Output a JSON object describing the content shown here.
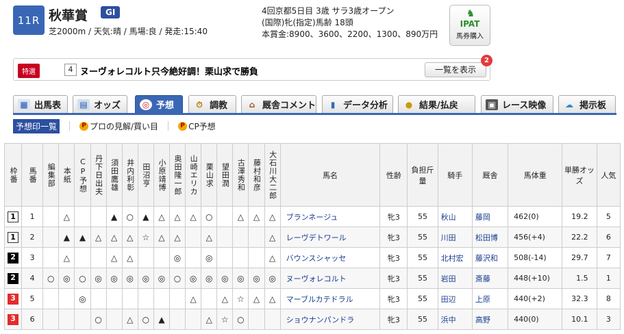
{
  "race": {
    "number": "11R",
    "name": "秋華賞",
    "grade": "GI",
    "conditions": "芝2000m / 天気:晴 / 馬場:良 / 発走:15:40",
    "info_line1": "4回京都5日目 3歳 サラ3歳オープン",
    "info_line2": "(国際)牝(指定)馬齢 18頭",
    "info_line3": "本賞金:8900、3600、2200、1300、890万円"
  },
  "ipat": {
    "logo": "IPAT",
    "label": "馬券購入"
  },
  "news": {
    "tag": "特選",
    "horse_num": "4",
    "text": "ヌーヴォレコルト只今絶好調！栗山求で勝負",
    "button": "一覧を表示",
    "badge": "2"
  },
  "tabs": [
    {
      "label": "出馬表",
      "icon": "table-icon"
    },
    {
      "label": "オッズ",
      "icon": "grid-icon"
    },
    {
      "label": "予想",
      "icon": "target-icon"
    },
    {
      "label": "調教",
      "icon": "stopwatch-icon"
    },
    {
      "label": "厩舎コメント",
      "icon": "stable-icon"
    },
    {
      "label": "データ分析",
      "icon": "bar-chart-icon"
    },
    {
      "label": "結果/払戻",
      "icon": "coins-icon"
    },
    {
      "label": "レース映像",
      "icon": "film-icon"
    },
    {
      "label": "掲示板",
      "icon": "chat-icon"
    }
  ],
  "subnav": {
    "item1": "予想印一覧",
    "item2": "プロの見解/買い目",
    "item3": "CP予想"
  },
  "table": {
    "headers": {
      "waku": "枠番",
      "umaban": "馬番",
      "p1": "編集部",
      "p2": "本紙",
      "p3": "CP予想",
      "p4": "丹下日出夫",
      "p5": "須田鷹雄",
      "p6": "井内利彰",
      "p7": "田沼亨",
      "p8": "小原靖博",
      "p9": "奥田隆一郎",
      "p10": "山崎エリカ",
      "p11": "栗山求",
      "p12": "望田潤",
      "p13": "古澤秀和",
      "p14": "藤村和彦",
      "p15": "大石川大二郎",
      "name": "馬名",
      "sex_age": "性齢",
      "weight_load": "負担斤量",
      "jockey": "騎手",
      "trainer": "厩舎",
      "body_weight": "馬体重",
      "odds": "単勝オッズ",
      "popularity": "人気"
    },
    "rows": [
      {
        "waku": "1",
        "umaban": "1",
        "marks": [
          "",
          "△",
          "",
          "",
          "▲",
          "○",
          "▲",
          "△",
          "△",
          "△",
          "○",
          "",
          "△",
          "△",
          "△"
        ],
        "name": "ブランネージュ",
        "sex_age": "牝3",
        "load": "55",
        "jockey": "秋山",
        "trainer": "藤岡",
        "weight": "462(0)",
        "odds": "19.2",
        "pop": "5"
      },
      {
        "waku": "1",
        "umaban": "2",
        "marks": [
          "",
          "▲",
          "▲",
          "△",
          "△",
          "△",
          "☆",
          "△",
          "△",
          "",
          "△",
          "",
          "",
          "",
          "△"
        ],
        "name": "レーヴデトワール",
        "sex_age": "牝3",
        "load": "55",
        "jockey": "川田",
        "trainer": "松田博",
        "weight": "456(+4)",
        "odds": "22.2",
        "pop": "6"
      },
      {
        "waku": "2",
        "umaban": "3",
        "marks": [
          "",
          "△",
          "",
          "",
          "△",
          "△",
          "",
          "",
          "◎",
          "",
          "◎",
          "",
          "",
          "",
          "△"
        ],
        "name": "バウンスシャッセ",
        "sex_age": "牝3",
        "load": "55",
        "jockey": "北村宏",
        "trainer": "藤沢和",
        "weight": "508(-14)",
        "odds": "29.7",
        "pop": "7"
      },
      {
        "waku": "2",
        "umaban": "4",
        "marks": [
          "○",
          "◎",
          "○",
          "◎",
          "◎",
          "◎",
          "◎",
          "◎",
          "○",
          "◎",
          "◎",
          "◎",
          "◎",
          "◎",
          "◎"
        ],
        "name": "ヌーヴォレコルト",
        "sex_age": "牝3",
        "load": "55",
        "jockey": "岩田",
        "trainer": "斎藤",
        "weight": "448(+10)",
        "odds": "1.5",
        "pop": "1"
      },
      {
        "waku": "3",
        "umaban": "5",
        "marks": [
          "",
          "",
          "◎",
          "",
          "",
          "",
          "",
          "",
          "",
          "△",
          "",
          "△",
          "☆",
          "△",
          "△"
        ],
        "name": "マーブルカテドラル",
        "sex_age": "牝3",
        "load": "55",
        "jockey": "田辺",
        "trainer": "上原",
        "weight": "440(+2)",
        "odds": "32.3",
        "pop": "8"
      },
      {
        "waku": "3",
        "umaban": "6",
        "marks": [
          "",
          "",
          "",
          "○",
          "",
          "△",
          "○",
          "▲",
          "",
          "",
          "△",
          "☆",
          "○",
          "",
          ""
        ],
        "name": "ショウナンパンドラ",
        "sex_age": "牝3",
        "load": "55",
        "jockey": "浜中",
        "trainer": "高野",
        "weight": "440(0)",
        "odds": "10.1",
        "pop": "3"
      }
    ]
  },
  "colors": {
    "accent": "#3a67b5",
    "tag_red": "#c8001e",
    "link": "#1a3d8f"
  }
}
